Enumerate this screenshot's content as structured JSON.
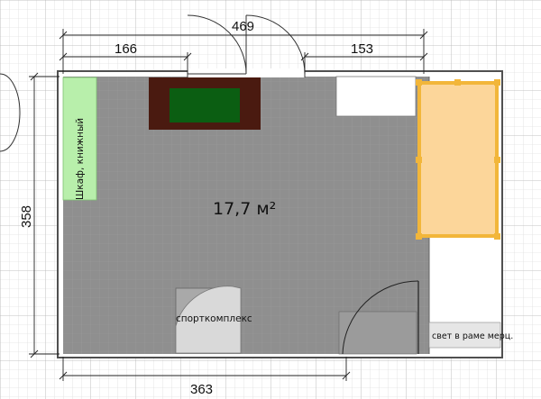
{
  "plan": {
    "area_label": "17,7 м²",
    "dimensions": {
      "top_total": "469",
      "top_left": "166",
      "top_right": "153",
      "left_height": "358",
      "bottom_width": "363"
    },
    "furniture": {
      "bookcase": "Шкаф, книжный",
      "sport_complex": "спорткомплекс",
      "lamp": "свет в раме мерц."
    },
    "colors": {
      "floor": "#8f8f8f",
      "wall": "#505050",
      "bookcase": "#b8efab",
      "bed": "#fcd69a",
      "bed_outline": "#f2b63a",
      "table_frame": "#4a1a10",
      "table_top": "#0b5e12",
      "grid": "#c9c9c9"
    }
  }
}
